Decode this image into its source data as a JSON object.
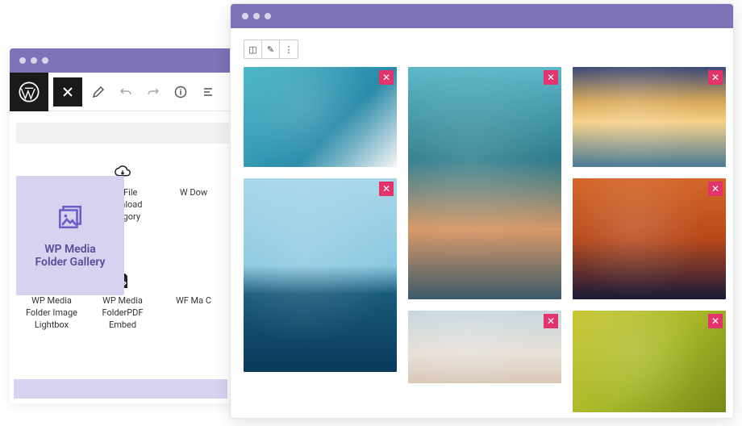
{
  "back": {
    "blocks": {
      "selected": {
        "label_line1": "WP Media",
        "label_line2": "Folder Gallery"
      },
      "r1c2": "WP File Download Category",
      "r1c3": "W Dow",
      "r2c1": "WP Media Folder Image Lightbox",
      "r2c2": "WP Media FolderPDF Embed",
      "r2c3": "WF Ma C"
    }
  },
  "front": {
    "toolbar": {
      "btn1": "◫",
      "btn2": "✎",
      "btn3": "⋮"
    },
    "gallery": {
      "delete_label": "✕"
    }
  }
}
